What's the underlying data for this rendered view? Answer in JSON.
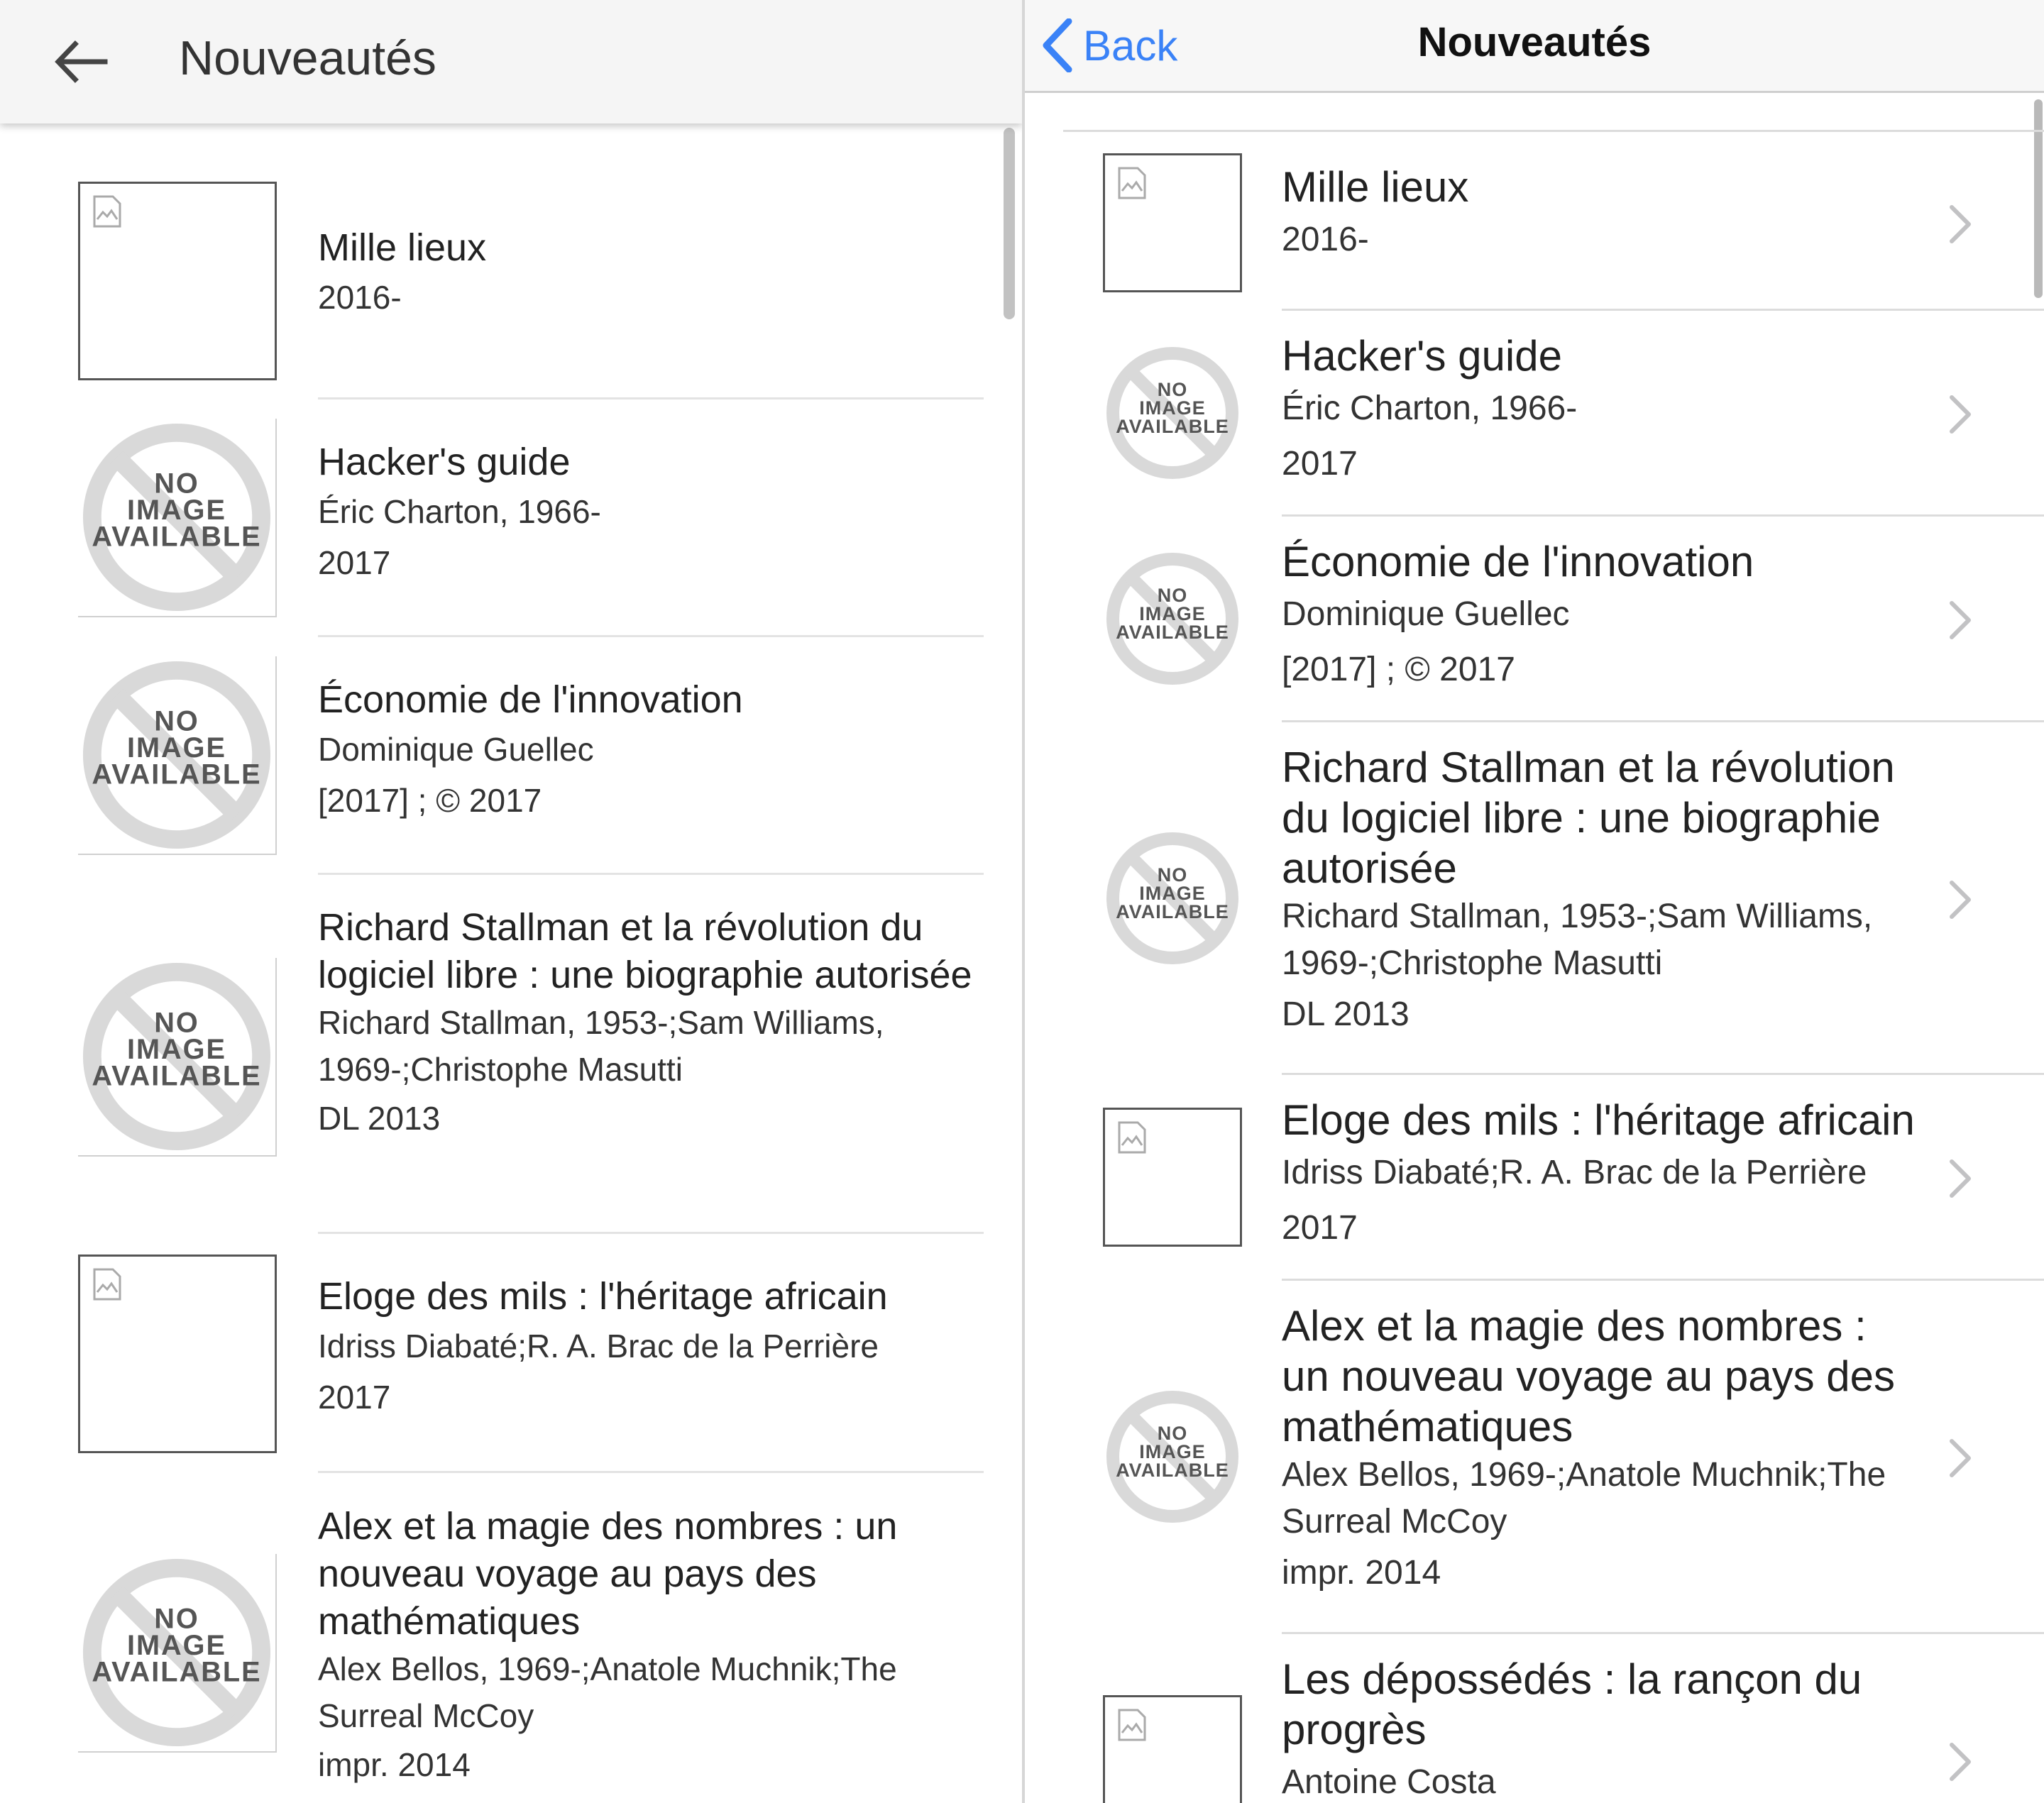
{
  "android": {
    "title": "Nouveautés",
    "items": [
      {
        "title": "Mille lieux",
        "authors": "",
        "year": "2016-",
        "thumb": "broken-image-icon"
      },
      {
        "title": "Hacker's guide",
        "authors": "Éric Charton, 1966-",
        "year": "2017",
        "thumb": "no-image-available-icon"
      },
      {
        "title": "Économie de l'innovation",
        "authors": "Dominique Guellec",
        "year": "[2017] ; © 2017",
        "thumb": "no-image-available-icon"
      },
      {
        "title": "Richard Stallman et la révolution du logiciel libre : une biographie autorisée",
        "authors": "Richard Stallman, 1953-;Sam Williams, 1969-;Christophe Masutti",
        "year": "DL 2013",
        "thumb": "no-image-available-icon"
      },
      {
        "title": "Eloge des mils : l'héritage africain",
        "authors": "Idriss Diabaté;R. A. Brac de la Perrière",
        "year": "2017",
        "thumb": "broken-image-icon"
      },
      {
        "title": "Alex et la magie des nombres : un nouveau voyage au pays des mathématiques",
        "authors": "Alex Bellos, 1969-;Anatole Muchnik;The Surreal McCoy",
        "year": "impr. 2014",
        "thumb": "no-image-available-icon"
      }
    ]
  },
  "ios": {
    "back_label": "Back",
    "title": "Nouveautés",
    "items": [
      {
        "title": "Mille lieux",
        "authors": "",
        "year": "2016-",
        "thumb": "broken-image-icon"
      },
      {
        "title": "Hacker's guide",
        "authors": "Éric Charton, 1966-",
        "year": "2017",
        "thumb": "no-image-available-icon"
      },
      {
        "title": "Économie de l'innovation",
        "authors": "Dominique Guellec",
        "year": "[2017] ; © 2017",
        "thumb": "no-image-available-icon"
      },
      {
        "title": "Richard Stallman et la révolution du logiciel libre : une biographie autorisée",
        "authors": "Richard Stallman, 1953-;Sam Williams, 1969-;Christophe Masutti",
        "year": "DL 2013",
        "thumb": "no-image-available-icon"
      },
      {
        "title": "Eloge des mils : l'héritage africain",
        "authors": "Idriss Diabaté;R. A. Brac de la Perrière",
        "year": "2017",
        "thumb": "broken-image-icon"
      },
      {
        "title": "Alex et la magie des nombres : un nouveau voyage au pays des mathématiques",
        "authors": "Alex Bellos, 1969-;Anatole Muchnik;The Surreal McCoy",
        "year": "impr. 2014",
        "thumb": "no-image-available-icon"
      },
      {
        "title": "Les dépossédés : la rançon du progrès",
        "authors": "Antoine Costa",
        "year": "",
        "thumb": "broken-image-icon"
      }
    ]
  },
  "placeholder_text": {
    "line1": "NO",
    "line2": "IMAGE",
    "line3": "AVAILABLE"
  },
  "colors": {
    "ios_accent": "#3a82f7",
    "placeholder_gray": "#d9d9d9",
    "separator": "#dcdcdc"
  }
}
